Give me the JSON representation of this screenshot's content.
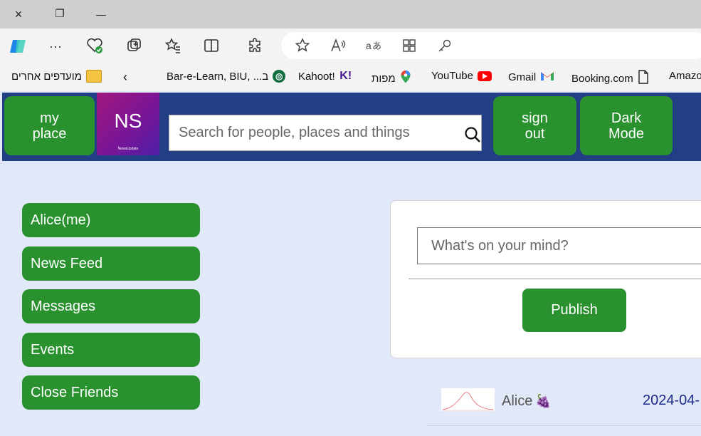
{
  "window": {
    "close_icon": "×",
    "restore_icon": "❐",
    "minimize_icon": "—"
  },
  "toolbar_icons": [
    "copilot-icon",
    "more-icon",
    "browser-essentials-icon",
    "collections-icon",
    "favorites-icon",
    "split-screen-icon",
    "extensions-icon"
  ],
  "address_icons": [
    "star-icon",
    "read-aloud-icon",
    "translate-icon",
    "app-available-icon",
    "key-icon"
  ],
  "bookmarks": {
    "other_favorites": "מועדפים אחרים",
    "items": [
      {
        "label": "Bar-e-Learn, BIU, ...ב",
        "icon_color": "#0f6b3e"
      },
      {
        "label": "Kahoot!",
        "icon_color": "#46178f"
      },
      {
        "label": "מפות",
        "icon_color": "#34a853"
      },
      {
        "label": "YouTube",
        "icon_color": "#ff0000"
      },
      {
        "label": "Gmail",
        "icon_color": "#ea4335"
      },
      {
        "label": "Booking.com",
        "icon_color": "#ffffff"
      },
      {
        "label": "Amazo",
        "icon_color": "#ffffff"
      }
    ]
  },
  "header": {
    "my_place": "my\nplace",
    "logo_text": "NS",
    "logo_subtext": "NewsUpdate",
    "search_placeholder": "Search for people, places and things",
    "sign_out": "sign\nout",
    "dark_mode": "Dark\nMode"
  },
  "sidebar": {
    "items": [
      {
        "label": "Alice(me)"
      },
      {
        "label": "News Feed"
      },
      {
        "label": "Messages"
      },
      {
        "label": "Events"
      },
      {
        "label": "Close Friends"
      }
    ]
  },
  "composer": {
    "placeholder": "What's on your mind?",
    "publish_label": "Publish"
  },
  "post": {
    "author": "Alice",
    "date": "2024-04-",
    "author_emoji": "🍇"
  },
  "colors": {
    "accent_green": "#2a912f",
    "header_blue": "#223f85",
    "page_bg": "#e1e8f7"
  }
}
